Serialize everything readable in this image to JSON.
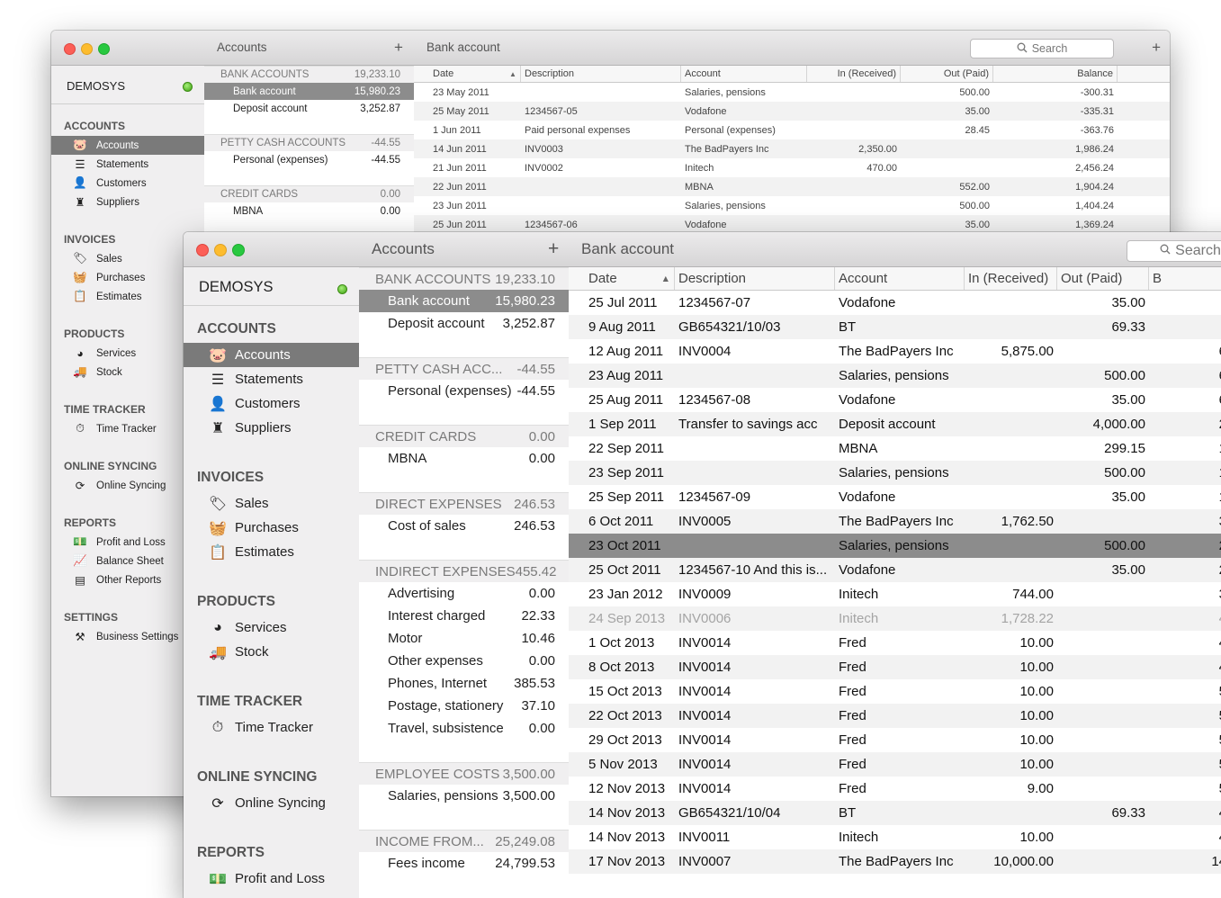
{
  "back_window": {
    "accounts_title": "Accounts",
    "bank_title": "Bank account",
    "plus": "+",
    "search_placeholder": "Search",
    "company": "DEMOSYS",
    "sidebar": [
      {
        "section": "ACCOUNTS",
        "items": [
          {
            "label": "Accounts",
            "icon": "piggy-bank-icon",
            "glyph": "🐷",
            "selected": true
          },
          {
            "label": "Statements",
            "icon": "statement-icon",
            "glyph": "☰"
          },
          {
            "label": "Customers",
            "icon": "customers-icon",
            "glyph": "👤"
          },
          {
            "label": "Suppliers",
            "icon": "suppliers-icon",
            "glyph": "♜"
          }
        ]
      },
      {
        "section": "INVOICES",
        "items": [
          {
            "label": "Sales",
            "icon": "sales-tag-icon",
            "glyph": "🏷"
          },
          {
            "label": "Purchases",
            "icon": "basket-icon",
            "glyph": "🧺"
          },
          {
            "label": "Estimates",
            "icon": "clipboard-icon",
            "glyph": "📋"
          }
        ]
      },
      {
        "section": "PRODUCTS",
        "items": [
          {
            "label": "Services",
            "icon": "pie-chart-icon",
            "glyph": "◕"
          },
          {
            "label": "Stock",
            "icon": "truck-icon",
            "glyph": "🚚"
          }
        ]
      },
      {
        "section": "TIME TRACKER",
        "items": [
          {
            "label": "Time Tracker",
            "icon": "stopwatch-icon",
            "glyph": "⏱"
          }
        ]
      },
      {
        "section": "ONLINE SYNCING",
        "items": [
          {
            "label": "Online Syncing",
            "icon": "sync-icon",
            "glyph": "⟳"
          }
        ]
      },
      {
        "section": "REPORTS",
        "items": [
          {
            "label": "Profit and Loss",
            "icon": "banknotes-icon",
            "glyph": "💵"
          },
          {
            "label": "Balance Sheet",
            "icon": "line-chart-icon",
            "glyph": "📈"
          },
          {
            "label": "Other Reports",
            "icon": "report-icon",
            "glyph": "▤"
          }
        ]
      },
      {
        "section": "SETTINGS",
        "items": [
          {
            "label": "Business Settings",
            "icon": "tools-icon",
            "glyph": "⚒"
          }
        ]
      }
    ],
    "account_groups": [
      {
        "name": "BANK ACCOUNTS",
        "total": "19,233.10",
        "rows": [
          {
            "name": "Bank account",
            "amount": "15,980.23",
            "selected": true
          },
          {
            "name": "Deposit account",
            "amount": "3,252.87"
          }
        ]
      },
      {
        "name": "PETTY CASH ACCOUNTS",
        "total": "-44.55",
        "rows": [
          {
            "name": "Personal (expenses)",
            "amount": "-44.55"
          }
        ]
      },
      {
        "name": "CREDIT CARDS",
        "total": "0.00",
        "rows": [
          {
            "name": "MBNA",
            "amount": "0.00"
          }
        ]
      }
    ],
    "columns": [
      "Date",
      "Description",
      "Account",
      "In (Received)",
      "Out (Paid)",
      "Balance"
    ],
    "sort_glyph": "▲",
    "rows": [
      [
        "23 May 2011",
        "",
        "Salaries, pensions",
        "",
        "500.00",
        "-300.31"
      ],
      [
        "25 May 2011",
        "1234567-05",
        "Vodafone",
        "",
        "35.00",
        "-335.31"
      ],
      [
        "1 Jun 2011",
        "Paid personal expenses",
        "Personal (expenses)",
        "",
        "28.45",
        "-363.76"
      ],
      [
        "14 Jun 2011",
        "INV0003",
        "The BadPayers Inc",
        "2,350.00",
        "",
        "1,986.24"
      ],
      [
        "21 Jun 2011",
        "INV0002",
        "Initech",
        "470.00",
        "",
        "2,456.24"
      ],
      [
        "22 Jun 2011",
        "",
        "MBNA",
        "",
        "552.00",
        "1,904.24"
      ],
      [
        "23 Jun 2011",
        "",
        "Salaries, pensions",
        "",
        "500.00",
        "1,404.24"
      ],
      [
        "25 Jun 2011",
        "1234567-06",
        "Vodafone",
        "",
        "35.00",
        "1,369.24"
      ]
    ]
  },
  "front_window": {
    "accounts_title": "Accounts",
    "bank_title": "Bank account",
    "plus": "+",
    "search_placeholder": "Search",
    "company": "DEMOSYS",
    "sidebar": [
      {
        "section": "ACCOUNTS",
        "items": [
          {
            "label": "Accounts",
            "icon": "piggy-bank-icon",
            "glyph": "🐷",
            "selected": true
          },
          {
            "label": "Statements",
            "icon": "statement-icon",
            "glyph": "☰"
          },
          {
            "label": "Customers",
            "icon": "customers-icon",
            "glyph": "👤"
          },
          {
            "label": "Suppliers",
            "icon": "suppliers-icon",
            "glyph": "♜"
          }
        ]
      },
      {
        "section": "INVOICES",
        "items": [
          {
            "label": "Sales",
            "icon": "sales-tag-icon",
            "glyph": "🏷"
          },
          {
            "label": "Purchases",
            "icon": "basket-icon",
            "glyph": "🧺"
          },
          {
            "label": "Estimates",
            "icon": "clipboard-icon",
            "glyph": "📋"
          }
        ]
      },
      {
        "section": "PRODUCTS",
        "items": [
          {
            "label": "Services",
            "icon": "pie-chart-icon",
            "glyph": "◕"
          },
          {
            "label": "Stock",
            "icon": "truck-icon",
            "glyph": "🚚"
          }
        ]
      },
      {
        "section": "TIME TRACKER",
        "items": [
          {
            "label": "Time Tracker",
            "icon": "stopwatch-icon",
            "glyph": "⏱"
          }
        ]
      },
      {
        "section": "ONLINE SYNCING",
        "items": [
          {
            "label": "Online Syncing",
            "icon": "sync-icon",
            "glyph": "⟳"
          }
        ]
      },
      {
        "section": "REPORTS",
        "items": [
          {
            "label": "Profit and Loss",
            "icon": "banknotes-icon",
            "glyph": "💵"
          }
        ]
      }
    ],
    "account_groups": [
      {
        "name": "BANK ACCOUNTS",
        "total": "19,233.10",
        "rows": [
          {
            "name": "Bank account",
            "amount": "15,980.23",
            "selected": true
          },
          {
            "name": "Deposit account",
            "amount": "3,252.87"
          }
        ]
      },
      {
        "name": "PETTY CASH ACC...",
        "total": "-44.55",
        "rows": [
          {
            "name": "Personal (expenses)",
            "amount": "-44.55"
          }
        ]
      },
      {
        "name": "CREDIT CARDS",
        "total": "0.00",
        "rows": [
          {
            "name": "MBNA",
            "amount": "0.00"
          }
        ]
      },
      {
        "name": "DIRECT EXPENSES",
        "total": "246.53",
        "rows": [
          {
            "name": "Cost of sales",
            "amount": "246.53"
          }
        ]
      },
      {
        "name": "INDIRECT EXPENSES",
        "total": "455.42",
        "rows": [
          {
            "name": "Advertising",
            "amount": "0.00"
          },
          {
            "name": "Interest charged",
            "amount": "22.33"
          },
          {
            "name": "Motor",
            "amount": "10.46"
          },
          {
            "name": "Other expenses",
            "amount": "0.00"
          },
          {
            "name": "Phones, Internet",
            "amount": "385.53"
          },
          {
            "name": "Postage, stationery",
            "amount": "37.10"
          },
          {
            "name": "Travel, subsistence",
            "amount": "0.00"
          }
        ]
      },
      {
        "name": "EMPLOYEE COSTS",
        "total": "3,500.00",
        "rows": [
          {
            "name": "Salaries, pensions",
            "amount": "3,500.00"
          }
        ]
      },
      {
        "name": "INCOME FROM...",
        "total": "25,249.08",
        "rows": [
          {
            "name": "Fees income",
            "amount": "24,799.53"
          }
        ]
      }
    ],
    "columns": [
      "Date",
      "Description",
      "Account",
      "In (Received)",
      "Out (Paid)",
      "B"
    ],
    "sort_glyph": "▲",
    "rows": [
      {
        "date": "25 Jul 2011",
        "desc": "1234567-07",
        "account": "Vodafone",
        "in": "",
        "out": "35.00",
        "bal": ""
      },
      {
        "date": "9 Aug 2011",
        "desc": "GB654321/10/03",
        "account": "BT",
        "in": "",
        "out": "69.33",
        "bal": ""
      },
      {
        "date": "12 Aug 2011",
        "desc": "INV0004",
        "account": "The BadPayers Inc",
        "in": "5,875.00",
        "out": "",
        "bal": "6"
      },
      {
        "date": "23 Aug 2011",
        "desc": "",
        "account": "Salaries, pensions",
        "in": "",
        "out": "500.00",
        "bal": "6"
      },
      {
        "date": "25 Aug 2011",
        "desc": "1234567-08",
        "account": "Vodafone",
        "in": "",
        "out": "35.00",
        "bal": "6"
      },
      {
        "date": "1 Sep 2011",
        "desc": "Transfer to savings acc",
        "account": "Deposit account",
        "in": "",
        "out": "4,000.00",
        "bal": "2"
      },
      {
        "date": "22 Sep 2011",
        "desc": "",
        "account": "MBNA",
        "in": "",
        "out": "299.15",
        "bal": "1"
      },
      {
        "date": "23 Sep 2011",
        "desc": "",
        "account": "Salaries, pensions",
        "in": "",
        "out": "500.00",
        "bal": "1"
      },
      {
        "date": "25 Sep 2011",
        "desc": "1234567-09",
        "account": "Vodafone",
        "in": "",
        "out": "35.00",
        "bal": "1"
      },
      {
        "date": "6 Oct 2011",
        "desc": "INV0005",
        "account": "The BadPayers Inc",
        "in": "1,762.50",
        "out": "",
        "bal": "3"
      },
      {
        "date": "23 Oct 2011",
        "desc": "",
        "account": "Salaries, pensions",
        "in": "",
        "out": "500.00",
        "bal": "2",
        "selected": true
      },
      {
        "date": "25 Oct 2011",
        "desc": "1234567-10 And this is...",
        "account": "Vodafone",
        "in": "",
        "out": "35.00",
        "bal": "2"
      },
      {
        "date": "23 Jan 2012",
        "desc": "INV0009",
        "account": "Initech",
        "in": "744.00",
        "out": "",
        "bal": "3"
      },
      {
        "date": "24 Sep 2013",
        "desc": "INV0006",
        "account": "Initech",
        "in": "1,728.22",
        "out": "",
        "bal": "4",
        "dimmed": true
      },
      {
        "date": "1 Oct 2013",
        "desc": "INV0014",
        "account": "Fred",
        "in": "10.00",
        "out": "",
        "bal": "4"
      },
      {
        "date": "8 Oct 2013",
        "desc": "INV0014",
        "account": "Fred",
        "in": "10.00",
        "out": "",
        "bal": "4"
      },
      {
        "date": "15 Oct 2013",
        "desc": "INV0014",
        "account": "Fred",
        "in": "10.00",
        "out": "",
        "bal": "5"
      },
      {
        "date": "22 Oct 2013",
        "desc": "INV0014",
        "account": "Fred",
        "in": "10.00",
        "out": "",
        "bal": "5"
      },
      {
        "date": "29 Oct 2013",
        "desc": "INV0014",
        "account": "Fred",
        "in": "10.00",
        "out": "",
        "bal": "5"
      },
      {
        "date": "5 Nov 2013",
        "desc": "INV0014",
        "account": "Fred",
        "in": "10.00",
        "out": "",
        "bal": "5"
      },
      {
        "date": "12 Nov 2013",
        "desc": "INV0014",
        "account": "Fred",
        "in": "9.00",
        "out": "",
        "bal": "5"
      },
      {
        "date": "14 Nov 2013",
        "desc": "GB654321/10/04",
        "account": "BT",
        "in": "",
        "out": "69.33",
        "bal": "4"
      },
      {
        "date": "14 Nov 2013",
        "desc": "INV0011",
        "account": "Initech",
        "in": "10.00",
        "out": "",
        "bal": "4"
      },
      {
        "date": "17 Nov 2013",
        "desc": "INV0007",
        "account": "The BadPayers Inc",
        "in": "10,000.00",
        "out": "",
        "bal": "14"
      }
    ]
  }
}
